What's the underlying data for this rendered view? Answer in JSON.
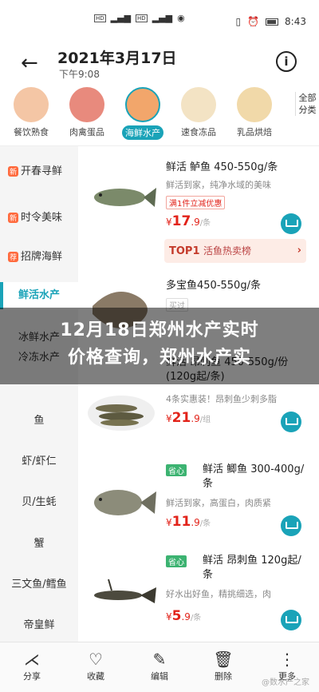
{
  "status": {
    "time": "8:43",
    "net1": "HD",
    "net2": "HD",
    "signal": "46"
  },
  "header": {
    "date": "2021年3月17日",
    "time": "下午9:08",
    "info_icon": "info-circle-icon"
  },
  "categories": [
    {
      "label": "餐饮熟食",
      "color": "#f4c6a5"
    },
    {
      "label": "肉禽蛋品",
      "color": "#e88a7d"
    },
    {
      "label": "海鲜水产",
      "color": "#f2a66b"
    },
    {
      "label": "速食冻品",
      "color": "#f3e3c4"
    },
    {
      "label": "乳品烘焙",
      "color": "#f1d9a9"
    }
  ],
  "all_categories": "全部分类",
  "sidebar": [
    {
      "label": "开春寻鲜",
      "badge": "新"
    },
    {
      "label": "时令美味",
      "badge": "新"
    },
    {
      "label": "招牌海鲜",
      "badge": "荐"
    },
    {
      "label": "鲜活水产",
      "badge": ""
    },
    {
      "label": "冰鲜水产",
      "badge": ""
    },
    {
      "label": "冷冻水产",
      "badge": ""
    },
    {
      "label": "鱼",
      "badge": ""
    },
    {
      "label": "虾/虾仁",
      "badge": ""
    },
    {
      "label": "贝/生蚝",
      "badge": ""
    },
    {
      "label": "蟹",
      "badge": ""
    },
    {
      "label": "三文鱼/鳕鱼",
      "badge": ""
    },
    {
      "label": "帝皇鲜",
      "badge": ""
    }
  ],
  "products": [
    {
      "name": "鲜活 鲈鱼 450-550g/条",
      "desc": "鲜活到家，纯净水域的美味",
      "tag": "满1件立减优惠",
      "price_int": "17",
      "price_dec": ".9",
      "unit": "/条"
    },
    {
      "name": "多宝鱼450-550g/条",
      "desc": "",
      "tag": "买过",
      "price_int": "",
      "price_dec": "",
      "unit": ""
    },
    {
      "name": "鲜活 昂刺鱼 450-550g/份(120g起/条)",
      "desc": "4条实惠装！昂刺鱼少刺多脂",
      "tag": "",
      "price_int": "21",
      "price_dec": ".9",
      "unit": "/组"
    },
    {
      "name": "鲜活 鲫鱼 300-400g/条",
      "desc": "鲜活到家，高蛋白，肉质紧",
      "tag": "省心",
      "price_int": "11",
      "price_dec": ".9",
      "unit": "/条"
    },
    {
      "name": "鲜活 昂刺鱼 120g起/条",
      "desc": "好水出好鱼，精挑细选，肉",
      "tag": "省心",
      "price_int": "5",
      "price_dec": ".9",
      "unit": "/条"
    }
  ],
  "top1": {
    "badge": "TOP1",
    "text": "活鱼热卖榜"
  },
  "banner": {
    "line1": "12月18日郑州水产实时",
    "line2": "价格查询，郑州水产实"
  },
  "bottom": [
    {
      "label": "分享",
      "icon": "share-icon"
    },
    {
      "label": "收藏",
      "icon": "heart-icon"
    },
    {
      "label": "编辑",
      "icon": "edit-icon"
    },
    {
      "label": "删除",
      "icon": "trash-icon"
    },
    {
      "label": "更多",
      "icon": "more-icon"
    }
  ],
  "watermark": "@数水产之家"
}
